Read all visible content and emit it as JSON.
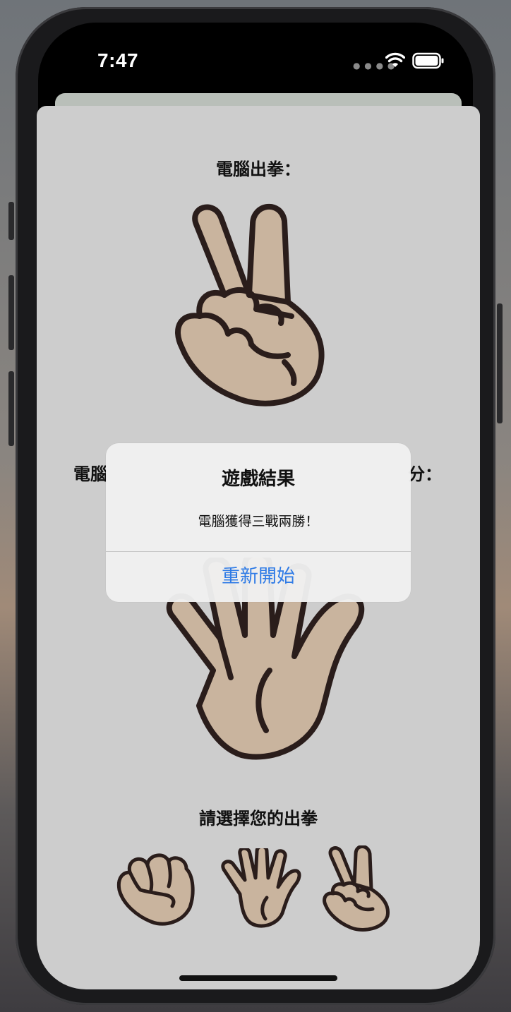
{
  "status_bar": {
    "time": "7:47",
    "wifi_icon": "wifi-icon",
    "battery_icon": "battery-icon"
  },
  "game": {
    "computer_label": "電腦出拳：",
    "computer_choice_icon": "scissors-hand-icon",
    "score_left_label": "電腦",
    "score_right_label": "分：",
    "player_choice_icon": "paper-hand-icon",
    "prompt_label": "請選擇您的出拳",
    "options": [
      {
        "icon": "rock-hand-icon"
      },
      {
        "icon": "paper-hand-icon"
      },
      {
        "icon": "scissors-hand-icon"
      }
    ]
  },
  "alert": {
    "title": "遊戲結果",
    "message": "電腦獲得三戰兩勝！",
    "button_label": "重新開始"
  },
  "colors": {
    "accent": "#2f7be6",
    "skin": "#c9b49e",
    "outline": "#2a1d1b",
    "sheet": "#cdcdcd"
  }
}
